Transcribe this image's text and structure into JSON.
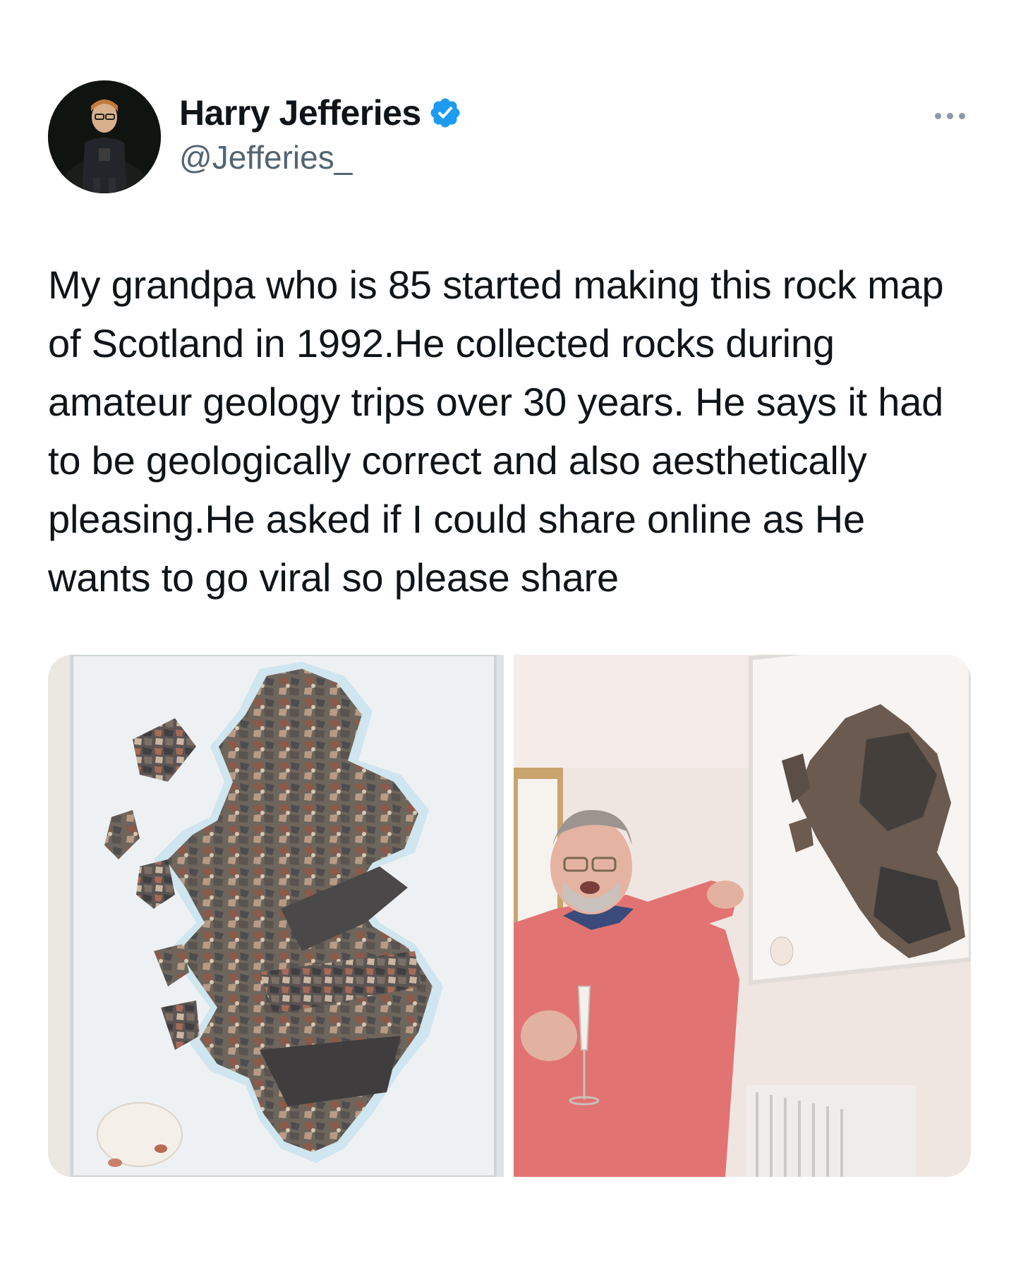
{
  "tweet": {
    "author": {
      "display_name": "Harry Jefferies",
      "handle": "@Jefferies_",
      "verified": true,
      "verified_icon": "verified-badge-icon",
      "avatar_icon": "avatar-photo"
    },
    "more_icon": "more-options-icon",
    "text": "My grandpa who is 85 started making this rock map of Scotland in 1992.He collected rocks during amateur geology trips over 30 years. He says it had to be geologically correct and also aesthetically pleasing.He asked if I could share online as He wants to go viral so please share",
    "media": [
      {
        "kind": "photo",
        "icon": "rock-map-photo"
      },
      {
        "kind": "photo",
        "icon": "grandpa-with-map-photo"
      }
    ]
  },
  "colors": {
    "text_primary": "#0f1419",
    "text_secondary": "#536471",
    "verified_blue": "#1d9bf0",
    "background": "#ffffff"
  }
}
